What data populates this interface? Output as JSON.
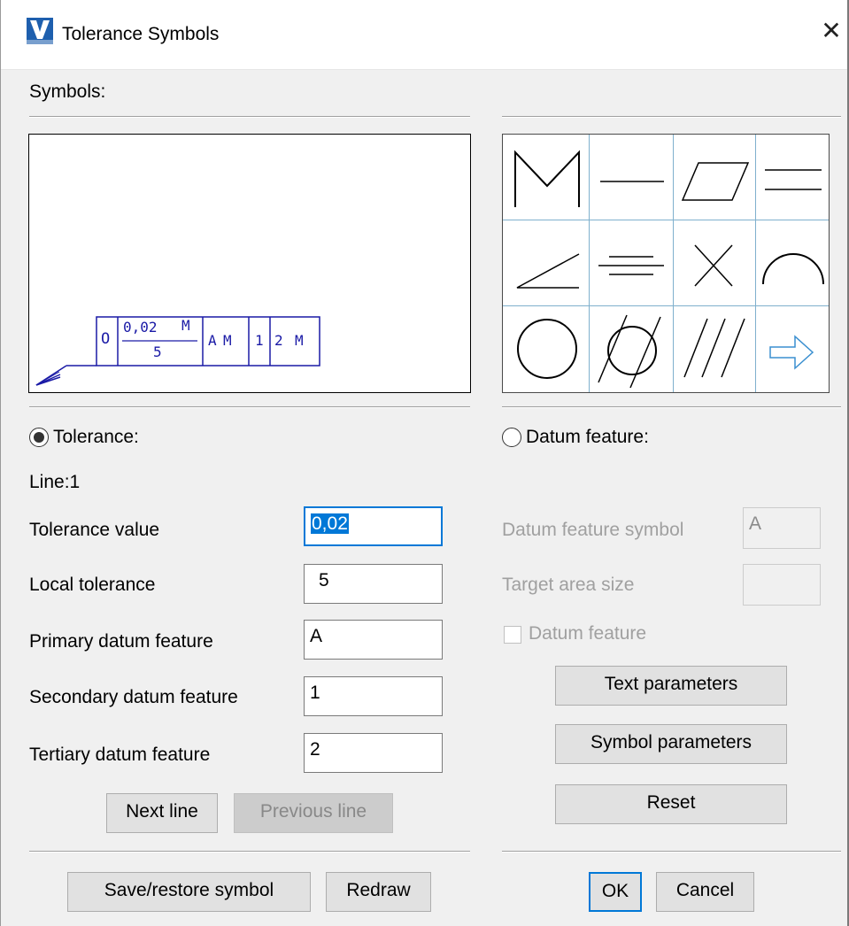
{
  "window": {
    "title": "Tolerance Symbols",
    "close_glyph": "✕",
    "icon": "app-logo-icon"
  },
  "symbols_label": "Symbols:",
  "preview": {
    "symbol_glyph": "O",
    "tolerance_value": "0,02",
    "modifier1": "M",
    "local_tolerance": "5",
    "primary": "A",
    "primary_mod": "M",
    "secondary": "1",
    "tertiary": "2",
    "tertiary_mod": "M"
  },
  "symbol_grid": [
    {
      "icon": "maximum-material-icon"
    },
    {
      "icon": "straightness-icon"
    },
    {
      "icon": "flatness-icon"
    },
    {
      "icon": "parallelism-icon"
    },
    {
      "icon": "angularity-icon"
    },
    {
      "icon": "symmetry-icon"
    },
    {
      "icon": "position-icon"
    },
    {
      "icon": "profile-of-line-icon"
    },
    {
      "icon": "circularity-icon"
    },
    {
      "icon": "cylindricity-icon"
    },
    {
      "icon": "total-runout-icon"
    },
    {
      "icon": "next-page-arrow-icon"
    }
  ],
  "tolerance": {
    "radio_label": "Tolerance:",
    "selected": true,
    "line_label": "Line:1",
    "fields": [
      {
        "label": "Tolerance value",
        "value": "0,02"
      },
      {
        "label": "Local tolerance",
        "value": "5"
      },
      {
        "label": "Primary datum feature",
        "value": "A"
      },
      {
        "label": "Secondary datum feature",
        "value": "1"
      },
      {
        "label": "Tertiary datum feature",
        "value": "2"
      }
    ],
    "next_line": "Next line",
    "previous_line": "Previous line"
  },
  "datum": {
    "radio_label": "Datum feature:",
    "selected": false,
    "symbol_label": "Datum feature symbol",
    "symbol_value": "A",
    "target_label": "Target area size",
    "target_value": "",
    "checkbox_label": "Datum feature",
    "checkbox_checked": false
  },
  "buttons": {
    "text_parameters": "Text parameters",
    "symbol_parameters": "Symbol parameters",
    "reset": "Reset",
    "save_restore": "Save/restore symbol",
    "redraw": "Redraw",
    "ok": "OK",
    "cancel": "Cancel"
  },
  "colors": {
    "accent": "#0078d7",
    "grid_lines": "#7fb0cd",
    "preview_frame": "#1a1aa6",
    "arrow": "#3a8fd0"
  }
}
